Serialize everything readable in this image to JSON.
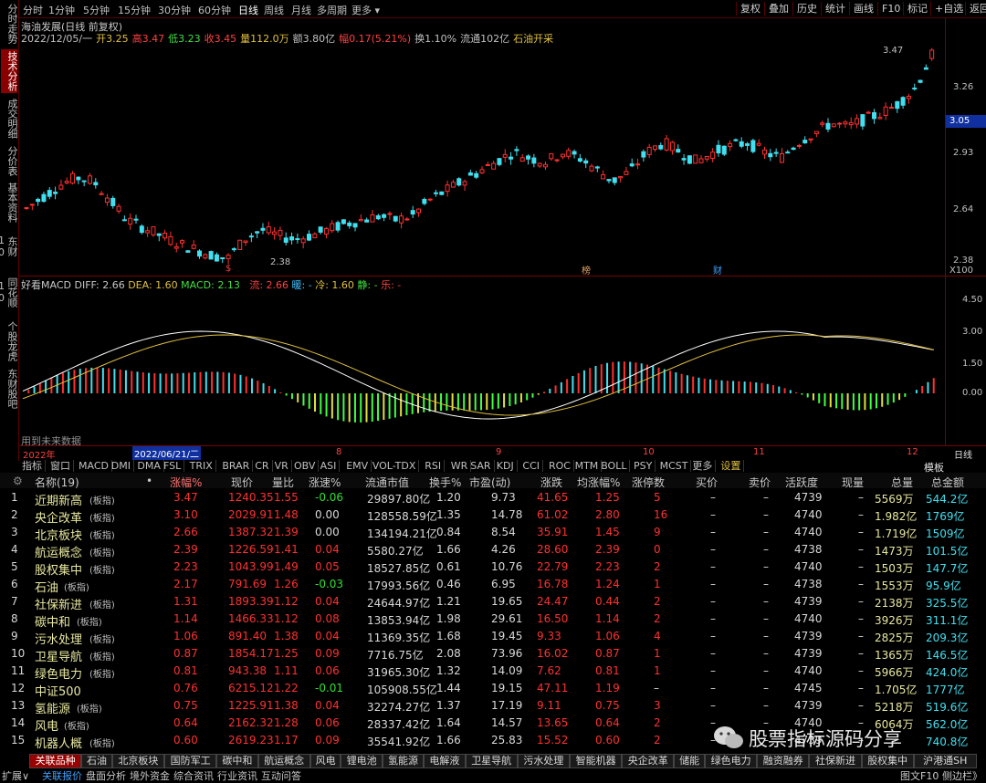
{
  "left_tabs": [
    {
      "label": "分时走势",
      "active": false
    },
    {
      "label": "技术分析",
      "active": true
    },
    {
      "label": "成交明细",
      "active": false
    },
    {
      "label": "分价表",
      "active": false
    },
    {
      "label": "基本资料",
      "active": false
    },
    {
      "label": "东财10",
      "active": false
    },
    {
      "label": "同花顺10",
      "active": false
    },
    {
      "label": "个股龙虎",
      "active": false
    },
    {
      "label": "东财股吧",
      "active": false
    }
  ],
  "periods": [
    {
      "label": "分时",
      "active": false
    },
    {
      "label": "1分钟",
      "active": false
    },
    {
      "label": "5分钟",
      "active": false
    },
    {
      "label": "15分钟",
      "active": false
    },
    {
      "label": "30分钟",
      "active": false
    },
    {
      "label": "60分钟",
      "active": false
    },
    {
      "label": "日线",
      "active": true
    },
    {
      "label": "周线",
      "active": false
    },
    {
      "label": "月线",
      "active": false
    },
    {
      "label": "多周期",
      "active": false
    },
    {
      "label": "更多 ▾",
      "active": false
    }
  ],
  "toolbar_right": [
    "复权",
    "叠加",
    "历史",
    "统计",
    "画线",
    "F10",
    "标记",
    "+自选",
    "返回"
  ],
  "chart_info": {
    "title": "海油发展(日线 前复权)",
    "line1": [
      {
        "text": "2022/12/05/一",
        "color": "#c0c0c0"
      },
      {
        "text": "开3.25",
        "color": "#e0c040"
      },
      {
        "text": "高3.47",
        "color": "#ff4040"
      },
      {
        "text": "低3.23",
        "color": "#40e040"
      },
      {
        "text": "收3.45",
        "color": "#ff4040"
      },
      {
        "text": "量112.0万",
        "color": "#e0c040"
      },
      {
        "text": "额3.80亿",
        "color": "#c0c0c0"
      },
      {
        "text": "幅0.17(5.21%)",
        "color": "#ff4040"
      },
      {
        "text": "换1.10%",
        "color": "#c0c0c0"
      },
      {
        "text": "流通102亿",
        "color": "#c0c0c0"
      },
      {
        "text": "石油开采",
        "color": "#e0c040"
      }
    ],
    "high_label": "3.47",
    "low_label": "2.38",
    "price_axis": [
      "3.26",
      "3.05",
      "2.93",
      "2.64",
      "2.38"
    ],
    "current_price": "3.05",
    "scale_label": "X100",
    "markers": [
      {
        "text": "$",
        "color": "#ff4040"
      },
      {
        "text": "榜",
        "color": "#e0a060"
      },
      {
        "text": "财",
        "color": "#40a0ff"
      }
    ]
  },
  "macd_info": {
    "title": "好看MACD",
    "diff": "DIFF: 2.66",
    "dea": "DEA: 1.60",
    "macd": "MACD: 2.13",
    "liu": "流: 2.66",
    "nuan": "暖: -",
    "leng": "冷: 1.60",
    "jing": "静: -",
    "le": "乐: -",
    "axis": [
      "4.50",
      "3.00",
      "1.50",
      "0.00"
    ],
    "future_note": "用到未来数据"
  },
  "date_axis": {
    "labels": [
      "2022年",
      "2022/06/21/二",
      "8",
      "9",
      "10",
      "11",
      "12"
    ],
    "right_label": "日线"
  },
  "indicators": [
    "指标",
    "窗口",
    "MACD",
    "DMI",
    "DMA",
    "FSL",
    "TRIX",
    "BRAR",
    "CR",
    "VR",
    "OBV",
    "ASI",
    "EMV",
    "VOL-TDX",
    "RSI",
    "WR",
    "SAR",
    "KDJ",
    "CCI",
    "ROC",
    "MTM",
    "BOLL",
    "PSY",
    "MCST",
    "更多",
    "设置"
  ],
  "template_label": "模板",
  "table": {
    "headers": [
      "名称(19)",
      "•",
      "涨幅%",
      "现价",
      "量比",
      "涨速%",
      "流通市值",
      "换手%",
      "市盈(动)",
      "涨跌",
      "均涨幅%",
      "涨停数",
      "买价",
      "卖价",
      "活跃度",
      "现量",
      "总量",
      "总金额"
    ],
    "rows": [
      {
        "no": "1",
        "name": "近期新高",
        "tag": "(板指)",
        "chg": "3.47",
        "price": "1240.35",
        "vr": "1.55",
        "spd": "-0.06",
        "cap": "29897.80亿",
        "turn": "1.20",
        "pe": "9.73",
        "diff": "41.65",
        "avg": "1.25",
        "lim": "5",
        "buy": "–",
        "sell": "–",
        "act": "4739",
        "cur": "–",
        "vol": "5569万",
        "amt": "544.2亿"
      },
      {
        "no": "2",
        "name": "央企改革",
        "tag": "(板指)",
        "chg": "3.10",
        "price": "2029.91",
        "vr": "1.48",
        "spd": "0.00",
        "cap": "128558.59亿",
        "turn": "1.35",
        "pe": "14.78",
        "diff": "61.02",
        "avg": "2.80",
        "lim": "16",
        "buy": "–",
        "sell": "–",
        "act": "4740",
        "cur": "–",
        "vol": "1.982亿",
        "amt": "1769亿"
      },
      {
        "no": "3",
        "name": "北京板块",
        "tag": "(板指)",
        "chg": "2.66",
        "price": "1387.32",
        "vr": "1.39",
        "spd": "0.00",
        "cap": "134194.21亿",
        "turn": "0.84",
        "pe": "8.54",
        "diff": "35.91",
        "avg": "1.45",
        "lim": "9",
        "buy": "–",
        "sell": "–",
        "act": "4740",
        "cur": "–",
        "vol": "1.719亿",
        "amt": "1509亿"
      },
      {
        "no": "4",
        "name": "航运概念",
        "tag": "(板指)",
        "chg": "2.39",
        "price": "1226.59",
        "vr": "1.41",
        "spd": "0.04",
        "cap": "5580.27亿",
        "turn": "1.66",
        "pe": "4.26",
        "diff": "28.60",
        "avg": "2.39",
        "lim": "0",
        "buy": "–",
        "sell": "–",
        "act": "4738",
        "cur": "–",
        "vol": "1473万",
        "amt": "101.5亿"
      },
      {
        "no": "5",
        "name": "股权集中",
        "tag": "(板指)",
        "chg": "2.23",
        "price": "1043.99",
        "vr": "1.49",
        "spd": "0.05",
        "cap": "18527.85亿",
        "turn": "0.61",
        "pe": "10.76",
        "diff": "22.79",
        "avg": "2.23",
        "lim": "2",
        "buy": "–",
        "sell": "–",
        "act": "4740",
        "cur": "–",
        "vol": "1503万",
        "amt": "147.7亿"
      },
      {
        "no": "6",
        "name": "石油",
        "tag": "(板指)",
        "chg": "2.17",
        "price": "791.69",
        "vr": "1.26",
        "spd": "-0.03",
        "cap": "17993.56亿",
        "turn": "0.46",
        "pe": "6.95",
        "diff": "16.78",
        "avg": "1.24",
        "lim": "1",
        "buy": "–",
        "sell": "–",
        "act": "4738",
        "cur": "–",
        "vol": "1553万",
        "amt": "95.9亿"
      },
      {
        "no": "7",
        "name": "社保新进",
        "tag": "(板指)",
        "chg": "1.31",
        "price": "1893.39",
        "vr": "1.12",
        "spd": "0.04",
        "cap": "24644.97亿",
        "turn": "1.21",
        "pe": "19.65",
        "diff": "24.47",
        "avg": "0.44",
        "lim": "2",
        "buy": "–",
        "sell": "–",
        "act": "4739",
        "cur": "–",
        "vol": "2138万",
        "amt": "325.5亿"
      },
      {
        "no": "8",
        "name": "碳中和",
        "tag": "(板指)",
        "chg": "1.14",
        "price": "1466.33",
        "vr": "1.12",
        "spd": "0.08",
        "cap": "13853.94亿",
        "turn": "1.98",
        "pe": "29.61",
        "diff": "16.50",
        "avg": "1.14",
        "lim": "2",
        "buy": "–",
        "sell": "–",
        "act": "4740",
        "cur": "–",
        "vol": "3926万",
        "amt": "311.1亿"
      },
      {
        "no": "9",
        "name": "污水处理",
        "tag": "(板指)",
        "chg": "1.06",
        "price": "891.40",
        "vr": "1.38",
        "spd": "0.04",
        "cap": "11369.35亿",
        "turn": "1.68",
        "pe": "19.45",
        "diff": "9.33",
        "avg": "1.06",
        "lim": "4",
        "buy": "–",
        "sell": "–",
        "act": "4739",
        "cur": "–",
        "vol": "2825万",
        "amt": "209.3亿"
      },
      {
        "no": "10",
        "name": "卫星导航",
        "tag": "(板指)",
        "chg": "0.87",
        "price": "1854.17",
        "vr": "1.25",
        "spd": "0.09",
        "cap": "7716.75亿",
        "turn": "2.08",
        "pe": "73.96",
        "diff": "16.02",
        "avg": "0.87",
        "lim": "1",
        "buy": "–",
        "sell": "–",
        "act": "4739",
        "cur": "–",
        "vol": "1365万",
        "amt": "146.5亿"
      },
      {
        "no": "11",
        "name": "绿色电力",
        "tag": "(板指)",
        "chg": "0.81",
        "price": "943.38",
        "vr": "1.11",
        "spd": "0.06",
        "cap": "31965.30亿",
        "turn": "1.32",
        "pe": "14.09",
        "diff": "7.62",
        "avg": "0.81",
        "lim": "1",
        "buy": "–",
        "sell": "–",
        "act": "4740",
        "cur": "–",
        "vol": "5966万",
        "amt": "424.0亿"
      },
      {
        "no": "12",
        "name": "中证500",
        "tag": "",
        "chg": "0.76",
        "price": "6215.12",
        "vr": "1.22",
        "spd": "-0.01",
        "cap": "105908.55亿",
        "turn": "1.44",
        "pe": "19.15",
        "diff": "47.11",
        "avg": "1.19",
        "lim": "–",
        "buy": "–",
        "sell": "–",
        "act": "4745",
        "cur": "–",
        "vol": "1.705亿",
        "amt": "1777亿"
      },
      {
        "no": "13",
        "name": "氢能源",
        "tag": "(板指)",
        "chg": "0.75",
        "price": "1225.91",
        "vr": "1.38",
        "spd": "0.04",
        "cap": "32274.27亿",
        "turn": "1.37",
        "pe": "17.19",
        "diff": "9.11",
        "avg": "0.75",
        "lim": "3",
        "buy": "–",
        "sell": "–",
        "act": "4739",
        "cur": "–",
        "vol": "5218万",
        "amt": "519.6亿"
      },
      {
        "no": "14",
        "name": "风电",
        "tag": "(板指)",
        "chg": "0.64",
        "price": "2162.32",
        "vr": "1.28",
        "spd": "0.06",
        "cap": "28337.42亿",
        "turn": "1.64",
        "pe": "14.57",
        "diff": "13.65",
        "avg": "0.64",
        "lim": "2",
        "buy": "–",
        "sell": "–",
        "act": "4740",
        "cur": "–",
        "vol": "6064万",
        "amt": "562.0亿"
      },
      {
        "no": "15",
        "name": "机器人概",
        "tag": "(板指)",
        "chg": "0.60",
        "price": "2619.23",
        "vr": "1.17",
        "spd": "0.09",
        "cap": "35541.92亿",
        "turn": "1.66",
        "pe": "25.83",
        "diff": "15.52",
        "avg": "0.60",
        "lim": "2",
        "buy": "–",
        "sell": "–",
        "act": "4739",
        "cur": "–",
        "vol": "",
        "amt": "740.8亿"
      }
    ]
  },
  "bottom_tabs": [
    "关联品种",
    "石油",
    "北京板块",
    "国防军工",
    "碳中和",
    "航运概念",
    "风电",
    "锂电池",
    "氢能源",
    "电解液",
    "卫星导航",
    "污水处理",
    "智能机器",
    "央企改革",
    "储能",
    "绿色电力",
    "融资融券",
    "社保新进",
    "股权集中",
    "沪港通SH"
  ],
  "status_bar": {
    "items": [
      "扩展∨",
      "关联报价",
      "盘面分析",
      "境外资金",
      "综合资讯",
      "行业资讯",
      "互动问答"
    ],
    "right": "图文F10",
    "sidebar": "侧边栏》"
  },
  "watermark": "股票指标源码分享",
  "colors": {
    "up": "#ff3030",
    "down": "#40e0f0",
    "yellow": "#e8e8a0",
    "green": "#40ff40",
    "border": "#7a0000"
  }
}
